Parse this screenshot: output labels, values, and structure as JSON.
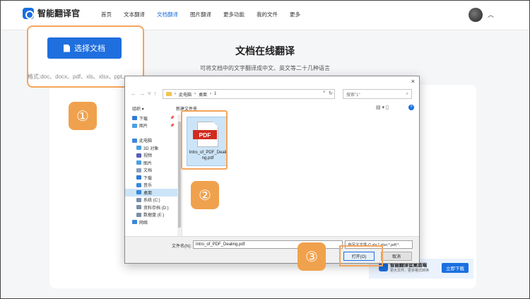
{
  "app": {
    "name": "智能翻译官"
  },
  "nav": {
    "items": [
      "首页",
      "文本翻译",
      "文档翻译",
      "图片翻译",
      "更多功能",
      "我的文件",
      "更多"
    ],
    "active_index": 2
  },
  "main": {
    "title": "文档在线翻译",
    "subtitle": "可将文档中的文字翻译成中文、英文等二十几种语言",
    "select_button": "选择文档",
    "formats": "格式:doc、docx、pdf、xls、xlsx、ppt、"
  },
  "steps": [
    "①",
    "②",
    "③"
  ],
  "banner": {
    "title": "智能翻译官桌面端",
    "sub": "更大文件、更多格式转换",
    "button": "立即下载"
  },
  "dialog": {
    "close": "×",
    "breadcrumb": [
      "此电脑",
      "桌面",
      "1"
    ],
    "search_placeholder": "搜索\"1\"",
    "organize": "组织 ▾",
    "new_folder": "新建文件夹",
    "sidebar": [
      {
        "label": "下载",
        "color": "#2e7bd6",
        "pinned": true
      },
      {
        "label": "图片",
        "color": "#4aa0e0",
        "pinned": true
      },
      {
        "label": "",
        "color": "",
        "pinned": false
      },
      {
        "label": "此电脑",
        "color": "#3a88d8",
        "pinned": false
      },
      {
        "label": "3D 对象",
        "color": "#4aa0e0",
        "pinned": false
      },
      {
        "label": "视频",
        "color": "#5560b0",
        "pinned": false
      },
      {
        "label": "图片",
        "color": "#4aa0e0",
        "pinned": false
      },
      {
        "label": "文档",
        "color": "#8aa0b8",
        "pinned": false
      },
      {
        "label": "下载",
        "color": "#2e7bd6",
        "pinned": false
      },
      {
        "label": "音乐",
        "color": "#3a88d8",
        "pinned": false
      },
      {
        "label": "桌面",
        "color": "#3a88d8",
        "pinned": false
      },
      {
        "label": "系统 (C:)",
        "color": "#7a8fa6",
        "pinned": false
      },
      {
        "label": "资料存档 (D:)",
        "color": "#7a8fa6",
        "pinned": false
      },
      {
        "label": "数据盘 (E:)",
        "color": "#7a8fa6",
        "pinned": false
      },
      {
        "label": "网络",
        "color": "#3a88d8",
        "pinned": false
      }
    ],
    "selected_sidebar_index": 10,
    "file": {
      "type_label": "PDF",
      "name": "Intro_of_PDF_Dealing.pdf"
    },
    "filename_label": "文件名(N):",
    "filename_value": "Intro_of_PDF_Dealing.pdf",
    "filetype_value": "自定义文件 (*.xls;*.xlsx;*.pdf;*.",
    "open_button": "打开(O)",
    "cancel_button": "取消"
  }
}
